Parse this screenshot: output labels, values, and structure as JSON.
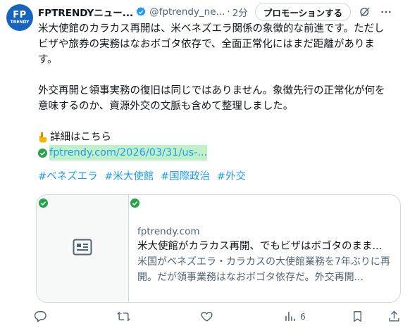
{
  "author": {
    "name": "FPTRENDYニュー...",
    "handle": "@fptrendy_ne...",
    "time": "2分",
    "avatar_line1": "FP",
    "avatar_line2": "TRENDY"
  },
  "promote_label": "プロモーションする",
  "tweet": {
    "line1": "米大使館のカラカス再開は、米ベネズエラ関係の象徴的な前進です。ただし",
    "line2": "ビザや旅券の実務はなおボゴタ依存で、全面正常化にはまだ距離がありま",
    "line3": "す。",
    "line4": "外交再開と領事実務の復旧は同じではありません。象徴先行の正常化が何を",
    "line5": "意味するのか、資源外交の文脈も含めて整理しました。",
    "details": "詳細はこちら",
    "link": "fptrendy.com/2026/03/31/us-...",
    "hashtags": [
      "#ベネズエラ",
      "#米大使館",
      "#国際政治",
      "#外交"
    ]
  },
  "card": {
    "domain": "fptrendy.com",
    "title": "米大使館がカラカス再開、でもビザはボゴタのまま...",
    "description": "米国がベネズエラ・カラカスの大使館業務を7年ぶりに再開。だが領事業務はなおボゴタ依存だ。外交再開..."
  },
  "actions": {
    "views": "6"
  },
  "colors": {
    "link": "#1d9bf0",
    "secondary_text": "#536471",
    "avatar_bg": "#1565c0",
    "check_green": "#22a447"
  }
}
